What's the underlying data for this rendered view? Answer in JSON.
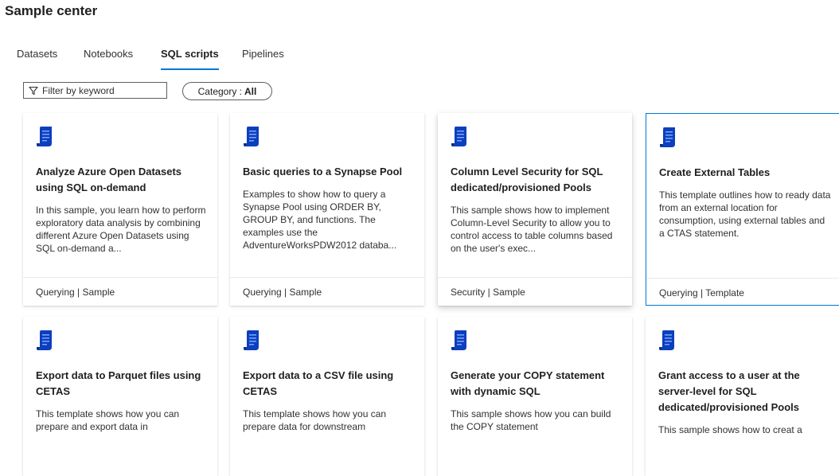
{
  "page": {
    "title": "Sample center"
  },
  "tabs": [
    {
      "label": "Datasets"
    },
    {
      "label": "Notebooks"
    },
    {
      "label": "SQL scripts",
      "active": true
    },
    {
      "label": "Pipelines"
    }
  ],
  "filter": {
    "placeholder": "Filter by keyword",
    "icon": "funnel-icon"
  },
  "category": {
    "label": "Category :",
    "value": "All"
  },
  "colors": {
    "accent": "#0078d4",
    "icon_blue": "#0b3fbd"
  },
  "cards": [
    {
      "title": "Analyze Azure Open Datasets using SQL on-demand",
      "description": "In this sample, you learn how to perform exploratory data analysis by combining different Azure Open Datasets using SQL on-demand a...",
      "footer": "Querying | Sample",
      "icon": "sql-script-icon"
    },
    {
      "title": "Basic queries to a Synapse Pool",
      "description": "Examples to show how to query a Synapse Pool using ORDER BY, GROUP BY, and functions. The examples use the AdventureWorksPDW2012 databa...",
      "footer": "Querying | Sample",
      "icon": "sql-script-icon"
    },
    {
      "title": "Column Level Security for SQL dedicated/provisioned Pools",
      "description": "This sample shows how to implement Column-Level Security to allow you to control access to table columns based on the user's exec...",
      "footer": "Security | Sample",
      "icon": "sql-script-icon"
    },
    {
      "title": "Create External Tables",
      "description": "This template outlines how to ready data from an external location for consumption, using external tables and a CTAS statement.",
      "footer": "Querying | Template",
      "icon": "sql-script-icon"
    },
    {
      "title": "Export data to Parquet files using CETAS",
      "description": "This template shows how you can prepare and export data in",
      "icon": "sql-script-icon"
    },
    {
      "title": "Export data to a CSV file using CETAS",
      "description": "This template shows how you can prepare data for downstream",
      "icon": "sql-script-icon"
    },
    {
      "title": "Generate your COPY statement with dynamic SQL",
      "description": "This sample shows how you can build the COPY statement",
      "icon": "sql-script-icon"
    },
    {
      "title": "Grant access to a user at the server-level for SQL dedicated/provisioned Pools",
      "description": "This sample shows how to creat a",
      "icon": "sql-script-icon"
    }
  ]
}
